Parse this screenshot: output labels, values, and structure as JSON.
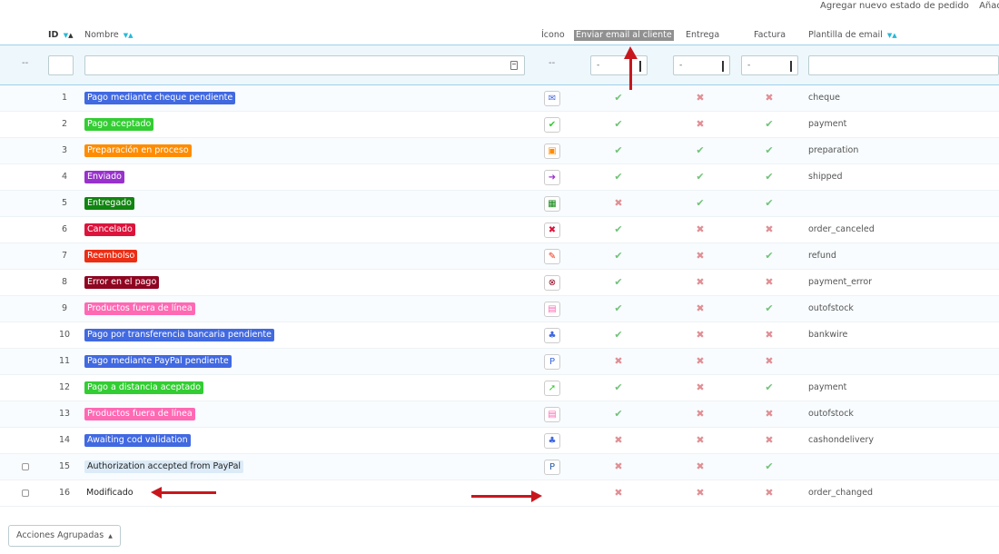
{
  "top_links": {
    "add_state": "Agregar nuevo estado de pedido",
    "add_next": "Añadir nu"
  },
  "columns": {
    "id": "ID",
    "name": "Nombre",
    "icon": "Ícono",
    "send_email": "Enviar email al cliente",
    "delivery": "Entrega",
    "invoice": "Factura",
    "template": "Plantilla de email"
  },
  "sort_arrows": {
    "down": "▼",
    "up": "▲"
  },
  "filter": {
    "id_placeholder": "--",
    "icon_placeholder": "--",
    "select_value": "-",
    "name_value": "",
    "template_value": ""
  },
  "colors": {
    "blue": "#4169e1",
    "green": "#32cd32",
    "orange": "#ff8c00",
    "purple": "#9932cc",
    "darkgreen": "#108510",
    "crimson": "#dc143c",
    "red": "#ec2e15",
    "darkred": "#8f0621",
    "pink": "#ff69b4",
    "paleblue": "#dcebf7",
    "check": "#72c279",
    "cross": "#e08f95",
    "annotation": "#c8161d"
  },
  "rows": [
    {
      "id": "1",
      "name": "Pago mediante cheque pendiente",
      "color": "#4169e1",
      "icon": "cheque-icon",
      "glyph": "✉",
      "send_email": true,
      "delivery": false,
      "invoice": false,
      "template": "cheque"
    },
    {
      "id": "2",
      "name": "Pago aceptado",
      "color": "#32cd32",
      "icon": "accepted-icon",
      "glyph": "✔",
      "send_email": true,
      "delivery": false,
      "invoice": true,
      "template": "payment"
    },
    {
      "id": "3",
      "name": "Preparación en proceso",
      "color": "#ff8c00",
      "icon": "box-icon",
      "glyph": "▣",
      "send_email": true,
      "delivery": true,
      "invoice": true,
      "template": "preparation"
    },
    {
      "id": "4",
      "name": "Enviado",
      "color": "#9932cc",
      "icon": "truck-icon",
      "glyph": "➜",
      "send_email": true,
      "delivery": true,
      "invoice": true,
      "template": "shipped"
    },
    {
      "id": "5",
      "name": "Entregado",
      "color": "#108510",
      "icon": "package-icon",
      "glyph": "▦",
      "send_email": false,
      "delivery": true,
      "invoice": true,
      "template": ""
    },
    {
      "id": "6",
      "name": "Cancelado",
      "color": "#dc143c",
      "icon": "cancel-icon",
      "glyph": "✖",
      "send_email": true,
      "delivery": false,
      "invoice": false,
      "template": "order_canceled"
    },
    {
      "id": "7",
      "name": "Reembolso",
      "color": "#ec2e15",
      "icon": "refund-icon",
      "glyph": "✎",
      "send_email": true,
      "delivery": false,
      "invoice": true,
      "template": "refund"
    },
    {
      "id": "8",
      "name": "Error en el pago",
      "color": "#8f0621",
      "icon": "error-icon",
      "glyph": "⊗",
      "send_email": true,
      "delivery": false,
      "invoice": false,
      "template": "payment_error"
    },
    {
      "id": "9",
      "name": "Productos fuera de línea",
      "color": "#ff69b4",
      "icon": "outofstock-icon",
      "glyph": "▤",
      "send_email": true,
      "delivery": false,
      "invoice": true,
      "template": "outofstock"
    },
    {
      "id": "10",
      "name": "Pago por transferencia bancaria pendiente",
      "color": "#4169e1",
      "icon": "coins-icon",
      "glyph": "♣",
      "send_email": true,
      "delivery": false,
      "invoice": false,
      "template": "bankwire"
    },
    {
      "id": "11",
      "name": "Pago mediante PayPal pendiente",
      "color": "#4169e1",
      "icon": "paypal-icon",
      "glyph": "P",
      "send_email": false,
      "delivery": false,
      "invoice": false,
      "template": ""
    },
    {
      "id": "12",
      "name": "Pago a distancia aceptado",
      "color": "#32cd32",
      "icon": "remote-icon",
      "glyph": "➚",
      "send_email": true,
      "delivery": false,
      "invoice": true,
      "template": "payment"
    },
    {
      "id": "13",
      "name": "Productos fuera de línea",
      "color": "#ff69b4",
      "icon": "outofstock-icon",
      "glyph": "▤",
      "send_email": true,
      "delivery": false,
      "invoice": false,
      "template": "outofstock"
    },
    {
      "id": "14",
      "name": "Awaiting cod validation",
      "color": "#4169e1",
      "icon": "coins-icon",
      "glyph": "♣",
      "send_email": false,
      "delivery": false,
      "invoice": false,
      "template": "cashondelivery"
    },
    {
      "id": "15",
      "name": "Authorization accepted from PayPal",
      "color": "#dcebf7",
      "icon": "paypal-icon",
      "glyph": "P",
      "send_email": false,
      "delivery": false,
      "invoice": true,
      "template": "",
      "checkbox": true,
      "light": true
    },
    {
      "id": "16",
      "name": "Modificado",
      "color": "",
      "icon": "",
      "glyph": "",
      "send_email": false,
      "delivery": false,
      "invoice": false,
      "template": "order_changed",
      "checkbox": true,
      "plain": true
    }
  ],
  "marks": {
    "yes": "✔",
    "no": "✖"
  },
  "bulk_actions": {
    "label": "Acciones Agrupadas",
    "caret": "▲"
  }
}
